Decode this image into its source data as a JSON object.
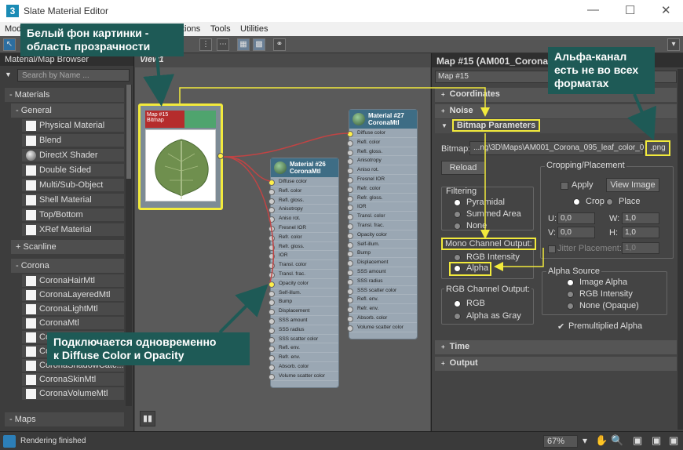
{
  "window": {
    "title": "Slate Material Editor",
    "logo": "3"
  },
  "menu": [
    "Mod",
    "tions",
    "Tools",
    "Utilities"
  ],
  "browser": {
    "header": "Material/Map Browser",
    "search_placeholder": "Search by Name ...",
    "groups": {
      "materials": "- Materials",
      "general": "- General",
      "scanline": "+ Scanline",
      "corona": "- Corona",
      "maps": "- Maps"
    },
    "general_items": [
      "Physical Material",
      "Blend",
      "DirectX Shader",
      "Double Sided",
      "Multi/Sub-Object",
      "Shell Material",
      "Top/Bottom",
      "XRef Material"
    ],
    "corona_items": [
      "CoronaHairMtl",
      "CoronaLayeredMtl",
      "CoronaLightMtl",
      "CoronaMtl",
      "Co",
      "Co",
      "CoronaShadowCatc...",
      "CoronaSkinMtl",
      "CoronaVolumeMtl"
    ]
  },
  "view": {
    "tab": "View1"
  },
  "nodes": {
    "bitmap": {
      "title": "Map #15",
      "subtitle": "Bitmap"
    },
    "mat26": {
      "title": "Material #26",
      "subtitle": "CoronaMtl"
    },
    "mat27": {
      "title": "Material #27",
      "subtitle": "CoronaMtl"
    },
    "slots26": [
      "Diffuse color",
      "Refl. color",
      "Refl. gloss.",
      "Anisotropy",
      "Aniso rot.",
      "Fresnel IOR",
      "Refr. color",
      "Refr. gloss.",
      "IOR",
      "Transl. color",
      "Transl. frac.",
      "Opacity color",
      "Self-illum.",
      "Bump",
      "Displacement",
      "SSS amount",
      "SSS radius",
      "SSS scatter color",
      "Refl. env.",
      "Refr. env.",
      "Absorb. color",
      "Volume scatter color"
    ],
    "slots27": [
      "Diffuse color",
      "Refl. color",
      "Refl. gloss.",
      "Anisotropy",
      "Aniso rot.",
      "Fresnel IOR",
      "Refr. color",
      "Refr. gloss.",
      "IOR",
      "Transl. color",
      "Transl. frac.",
      "Opacity color",
      "Self-illum.",
      "Bump",
      "Displacement",
      "SSS amount",
      "SSS radius",
      "SSS scatter color",
      "Refl. env.",
      "Refr. env.",
      "Absorb. color",
      "Volume scatter color"
    ]
  },
  "props": {
    "header": "Map #15 (AM001_Corona",
    "name_field": "Map #15",
    "rollouts": {
      "coordinates": "Coordinates",
      "noise": "Noise",
      "bitmap_params": "Bitmap Parameters",
      "time": "Time",
      "output": "Output"
    },
    "bitmap_label": "Bitmap:",
    "bitmap_path": "...ng\\3D\\Maps\\AM001_Corona_095_leaf_color_0",
    "bitmap_ext": ".png",
    "reload": "Reload",
    "cropping": {
      "title": "Cropping/Placement",
      "apply": "Apply",
      "view_image": "View Image",
      "crop": "Crop",
      "place": "Place",
      "u_label": "U:",
      "u_value": "0,0",
      "w_label": "W:",
      "w_value": "1,0",
      "v_label": "V:",
      "v_value": "0,0",
      "h_label": "H:",
      "h_value": "1,0",
      "jitter": "Jitter Placement:",
      "jitter_value": "1,0"
    },
    "filtering": {
      "title": "Filtering",
      "pyramidal": "Pyramidal",
      "summed": "Summed Area",
      "none": "None"
    },
    "mono": {
      "title": "Mono Channel Output:",
      "rgb_intensity": "RGB Intensity",
      "alpha": "Alpha"
    },
    "rgb": {
      "title": "RGB Channel Output:",
      "rgb": "RGB",
      "alpha_gray": "Alpha as Gray"
    },
    "alpha_source": {
      "title": "Alpha Source",
      "image_alpha": "Image Alpha",
      "rgb_intensity": "RGB Intensity",
      "none": "None (Opaque)",
      "premult": "Premultiplied Alpha"
    }
  },
  "callouts": {
    "top_left": "Белый фон картинки -\nобласть прозрачности",
    "top_right": "Альфа-канал\nесть не во всех\nформатах",
    "bottom": "Подключается одновременно\nк Diffuse Color и Opacity"
  },
  "status": {
    "text": "Rendering finished",
    "zoom": "67%"
  }
}
